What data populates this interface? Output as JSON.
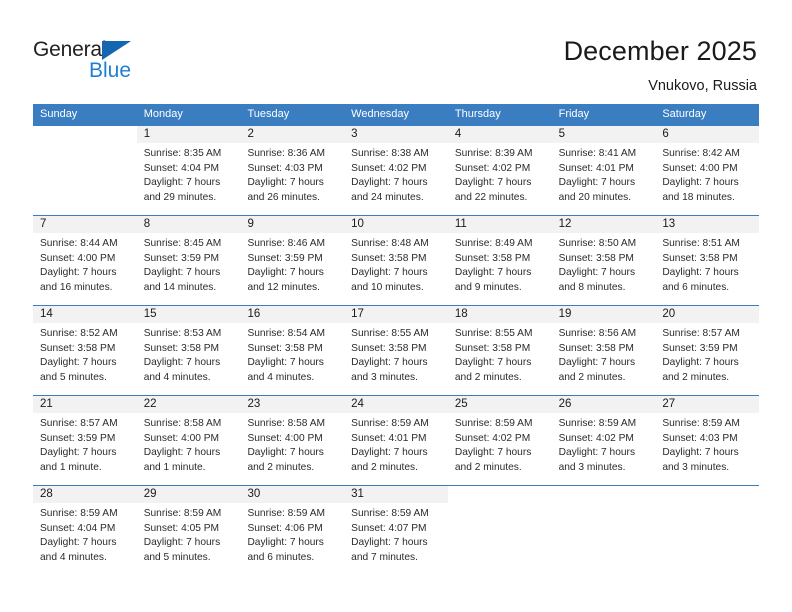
{
  "brand": {
    "name_dark": "General",
    "name_blue": "Blue",
    "accent_blue": "#1e7fd4",
    "triangle_blue": "#1565b0"
  },
  "header": {
    "title": "December 2025",
    "subtitle": "Vnukovo, Russia",
    "header_bar_color": "#3a7ec1",
    "daynum_band_color": "#f2f2f2"
  },
  "weekdays": [
    "Sunday",
    "Monday",
    "Tuesday",
    "Wednesday",
    "Thursday",
    "Friday",
    "Saturday"
  ],
  "weeks": [
    [
      {
        "day": "",
        "sunrise": "",
        "sunset": "",
        "daylight1": "",
        "daylight2": "",
        "filled": false
      },
      {
        "day": "1",
        "sunrise": "Sunrise: 8:35 AM",
        "sunset": "Sunset: 4:04 PM",
        "daylight1": "Daylight: 7 hours",
        "daylight2": "and 29 minutes.",
        "filled": true
      },
      {
        "day": "2",
        "sunrise": "Sunrise: 8:36 AM",
        "sunset": "Sunset: 4:03 PM",
        "daylight1": "Daylight: 7 hours",
        "daylight2": "and 26 minutes.",
        "filled": true
      },
      {
        "day": "3",
        "sunrise": "Sunrise: 8:38 AM",
        "sunset": "Sunset: 4:02 PM",
        "daylight1": "Daylight: 7 hours",
        "daylight2": "and 24 minutes.",
        "filled": true
      },
      {
        "day": "4",
        "sunrise": "Sunrise: 8:39 AM",
        "sunset": "Sunset: 4:02 PM",
        "daylight1": "Daylight: 7 hours",
        "daylight2": "and 22 minutes.",
        "filled": true
      },
      {
        "day": "5",
        "sunrise": "Sunrise: 8:41 AM",
        "sunset": "Sunset: 4:01 PM",
        "daylight1": "Daylight: 7 hours",
        "daylight2": "and 20 minutes.",
        "filled": true
      },
      {
        "day": "6",
        "sunrise": "Sunrise: 8:42 AM",
        "sunset": "Sunset: 4:00 PM",
        "daylight1": "Daylight: 7 hours",
        "daylight2": "and 18 minutes.",
        "filled": true
      }
    ],
    [
      {
        "day": "7",
        "sunrise": "Sunrise: 8:44 AM",
        "sunset": "Sunset: 4:00 PM",
        "daylight1": "Daylight: 7 hours",
        "daylight2": "and 16 minutes.",
        "filled": true
      },
      {
        "day": "8",
        "sunrise": "Sunrise: 8:45 AM",
        "sunset": "Sunset: 3:59 PM",
        "daylight1": "Daylight: 7 hours",
        "daylight2": "and 14 minutes.",
        "filled": true
      },
      {
        "day": "9",
        "sunrise": "Sunrise: 8:46 AM",
        "sunset": "Sunset: 3:59 PM",
        "daylight1": "Daylight: 7 hours",
        "daylight2": "and 12 minutes.",
        "filled": true
      },
      {
        "day": "10",
        "sunrise": "Sunrise: 8:48 AM",
        "sunset": "Sunset: 3:58 PM",
        "daylight1": "Daylight: 7 hours",
        "daylight2": "and 10 minutes.",
        "filled": true
      },
      {
        "day": "11",
        "sunrise": "Sunrise: 8:49 AM",
        "sunset": "Sunset: 3:58 PM",
        "daylight1": "Daylight: 7 hours",
        "daylight2": "and 9 minutes.",
        "filled": true
      },
      {
        "day": "12",
        "sunrise": "Sunrise: 8:50 AM",
        "sunset": "Sunset: 3:58 PM",
        "daylight1": "Daylight: 7 hours",
        "daylight2": "and 8 minutes.",
        "filled": true
      },
      {
        "day": "13",
        "sunrise": "Sunrise: 8:51 AM",
        "sunset": "Sunset: 3:58 PM",
        "daylight1": "Daylight: 7 hours",
        "daylight2": "and 6 minutes.",
        "filled": true
      }
    ],
    [
      {
        "day": "14",
        "sunrise": "Sunrise: 8:52 AM",
        "sunset": "Sunset: 3:58 PM",
        "daylight1": "Daylight: 7 hours",
        "daylight2": "and 5 minutes.",
        "filled": true
      },
      {
        "day": "15",
        "sunrise": "Sunrise: 8:53 AM",
        "sunset": "Sunset: 3:58 PM",
        "daylight1": "Daylight: 7 hours",
        "daylight2": "and 4 minutes.",
        "filled": true
      },
      {
        "day": "16",
        "sunrise": "Sunrise: 8:54 AM",
        "sunset": "Sunset: 3:58 PM",
        "daylight1": "Daylight: 7 hours",
        "daylight2": "and 4 minutes.",
        "filled": true
      },
      {
        "day": "17",
        "sunrise": "Sunrise: 8:55 AM",
        "sunset": "Sunset: 3:58 PM",
        "daylight1": "Daylight: 7 hours",
        "daylight2": "and 3 minutes.",
        "filled": true
      },
      {
        "day": "18",
        "sunrise": "Sunrise: 8:55 AM",
        "sunset": "Sunset: 3:58 PM",
        "daylight1": "Daylight: 7 hours",
        "daylight2": "and 2 minutes.",
        "filled": true
      },
      {
        "day": "19",
        "sunrise": "Sunrise: 8:56 AM",
        "sunset": "Sunset: 3:58 PM",
        "daylight1": "Daylight: 7 hours",
        "daylight2": "and 2 minutes.",
        "filled": true
      },
      {
        "day": "20",
        "sunrise": "Sunrise: 8:57 AM",
        "sunset": "Sunset: 3:59 PM",
        "daylight1": "Daylight: 7 hours",
        "daylight2": "and 2 minutes.",
        "filled": true
      }
    ],
    [
      {
        "day": "21",
        "sunrise": "Sunrise: 8:57 AM",
        "sunset": "Sunset: 3:59 PM",
        "daylight1": "Daylight: 7 hours",
        "daylight2": "and 1 minute.",
        "filled": true
      },
      {
        "day": "22",
        "sunrise": "Sunrise: 8:58 AM",
        "sunset": "Sunset: 4:00 PM",
        "daylight1": "Daylight: 7 hours",
        "daylight2": "and 1 minute.",
        "filled": true
      },
      {
        "day": "23",
        "sunrise": "Sunrise: 8:58 AM",
        "sunset": "Sunset: 4:00 PM",
        "daylight1": "Daylight: 7 hours",
        "daylight2": "and 2 minutes.",
        "filled": true
      },
      {
        "day": "24",
        "sunrise": "Sunrise: 8:59 AM",
        "sunset": "Sunset: 4:01 PM",
        "daylight1": "Daylight: 7 hours",
        "daylight2": "and 2 minutes.",
        "filled": true
      },
      {
        "day": "25",
        "sunrise": "Sunrise: 8:59 AM",
        "sunset": "Sunset: 4:02 PM",
        "daylight1": "Daylight: 7 hours",
        "daylight2": "and 2 minutes.",
        "filled": true
      },
      {
        "day": "26",
        "sunrise": "Sunrise: 8:59 AM",
        "sunset": "Sunset: 4:02 PM",
        "daylight1": "Daylight: 7 hours",
        "daylight2": "and 3 minutes.",
        "filled": true
      },
      {
        "day": "27",
        "sunrise": "Sunrise: 8:59 AM",
        "sunset": "Sunset: 4:03 PM",
        "daylight1": "Daylight: 7 hours",
        "daylight2": "and 3 minutes.",
        "filled": true
      }
    ],
    [
      {
        "day": "28",
        "sunrise": "Sunrise: 8:59 AM",
        "sunset": "Sunset: 4:04 PM",
        "daylight1": "Daylight: 7 hours",
        "daylight2": "and 4 minutes.",
        "filled": true
      },
      {
        "day": "29",
        "sunrise": "Sunrise: 8:59 AM",
        "sunset": "Sunset: 4:05 PM",
        "daylight1": "Daylight: 7 hours",
        "daylight2": "and 5 minutes.",
        "filled": true
      },
      {
        "day": "30",
        "sunrise": "Sunrise: 8:59 AM",
        "sunset": "Sunset: 4:06 PM",
        "daylight1": "Daylight: 7 hours",
        "daylight2": "and 6 minutes.",
        "filled": true
      },
      {
        "day": "31",
        "sunrise": "Sunrise: 8:59 AM",
        "sunset": "Sunset: 4:07 PM",
        "daylight1": "Daylight: 7 hours",
        "daylight2": "and 7 minutes.",
        "filled": true
      },
      {
        "day": "",
        "sunrise": "",
        "sunset": "",
        "daylight1": "",
        "daylight2": "",
        "filled": false
      },
      {
        "day": "",
        "sunrise": "",
        "sunset": "",
        "daylight1": "",
        "daylight2": "",
        "filled": false
      },
      {
        "day": "",
        "sunrise": "",
        "sunset": "",
        "daylight1": "",
        "daylight2": "",
        "filled": false
      }
    ]
  ]
}
